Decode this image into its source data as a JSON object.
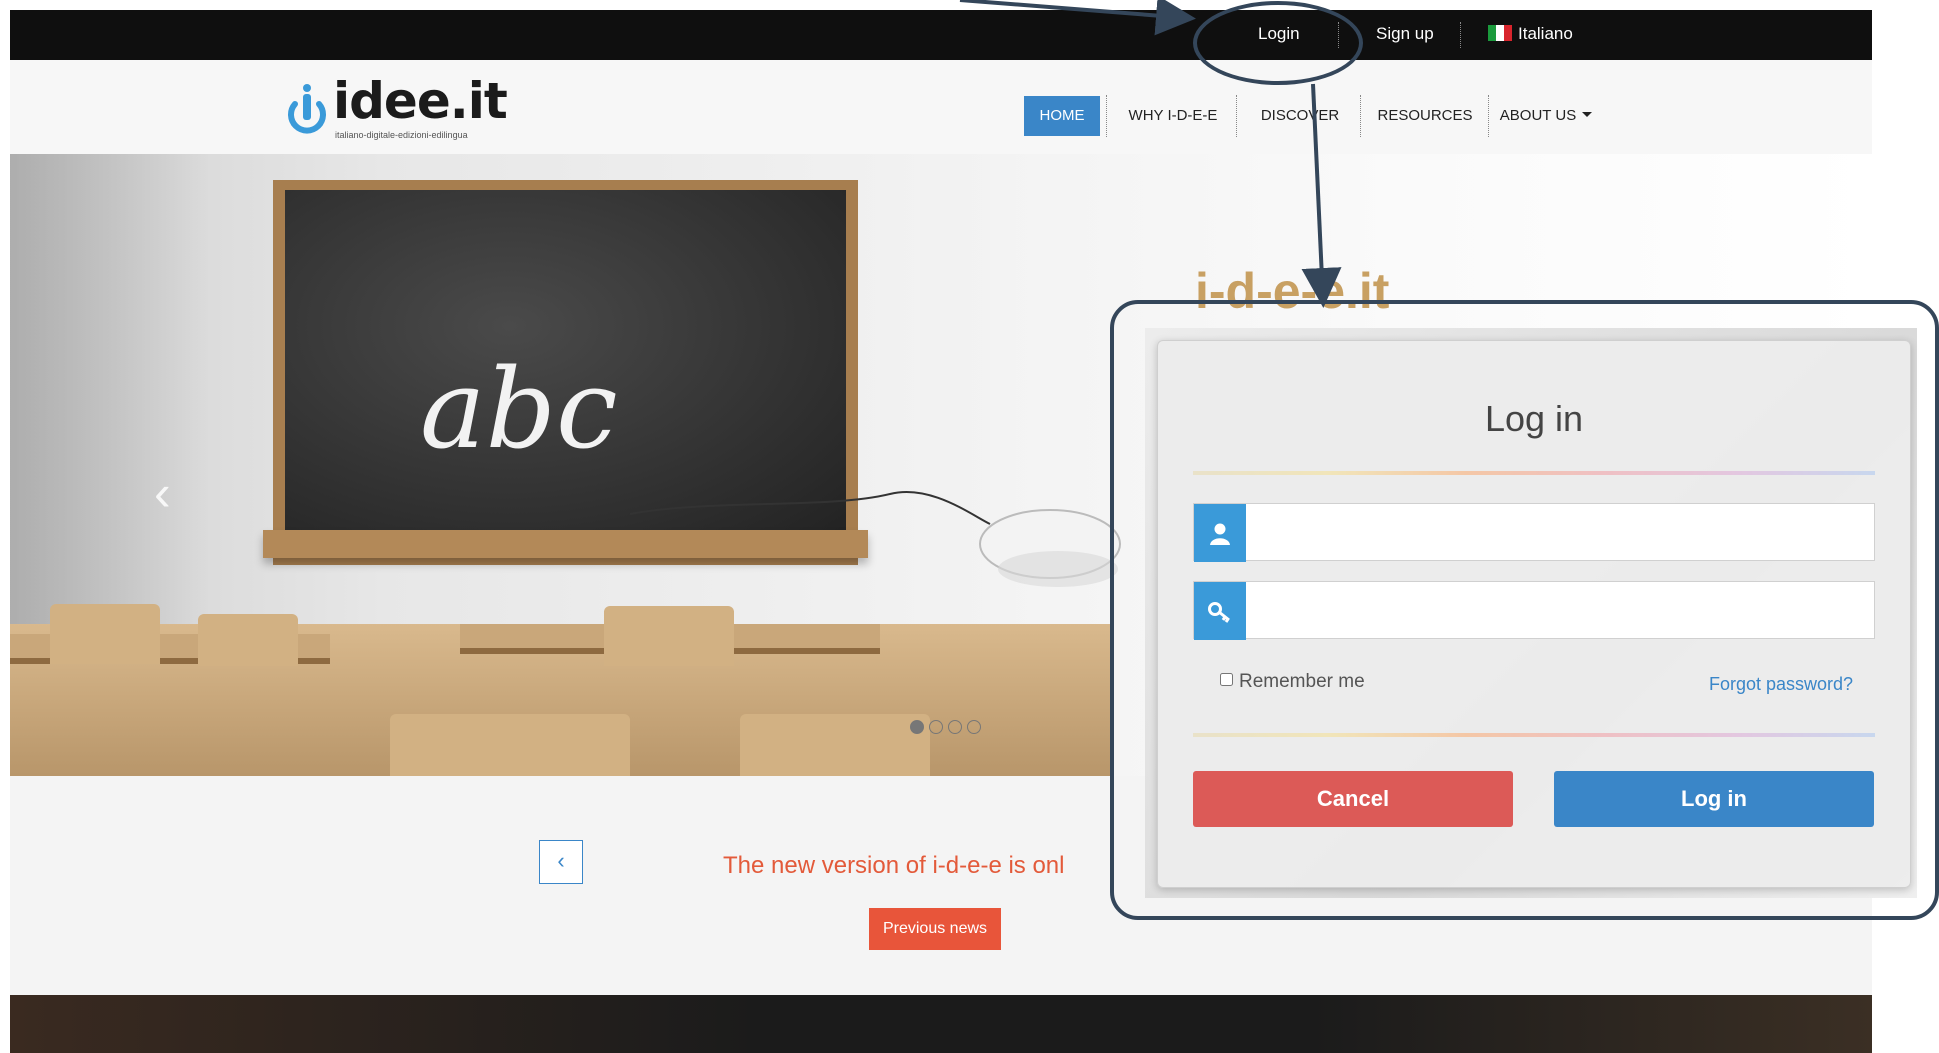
{
  "topbar": {
    "login": "Login",
    "signup": "Sign up",
    "language": "Italiano"
  },
  "brand": {
    "name": "idee.it",
    "tagline": "italiano-digitale-edizioni-edilingua"
  },
  "nav": {
    "items": [
      "HOME",
      "WHY I-D-E-E",
      "DISCOVER",
      "RESOURCES",
      "ABOUT US"
    ],
    "active": "HOME",
    "accent": "#3a86c8"
  },
  "hero": {
    "title": "i-d-e-e.it",
    "board_text": "abc",
    "prev_arrow_icon": "chevron-left-icon",
    "slides": 4,
    "active_slide": 1
  },
  "news": {
    "text": "The new version of i-d-e-e is onl",
    "prev_button": "Previous news",
    "prev_icon": "chevron-left-icon",
    "text_color": "#e35a3a"
  },
  "login_modal": {
    "title": "Log in",
    "username_icon": "user-icon",
    "password_icon": "key-icon",
    "username_value": "",
    "password_value": "",
    "remember_label": "Remember me",
    "forgot_label": "Forgot password?",
    "cancel_label": "Cancel",
    "submit_label": "Log in",
    "cancel_color": "#dc5a57",
    "submit_color": "#3a86c8"
  },
  "annotation": {
    "color": "#34465a"
  }
}
